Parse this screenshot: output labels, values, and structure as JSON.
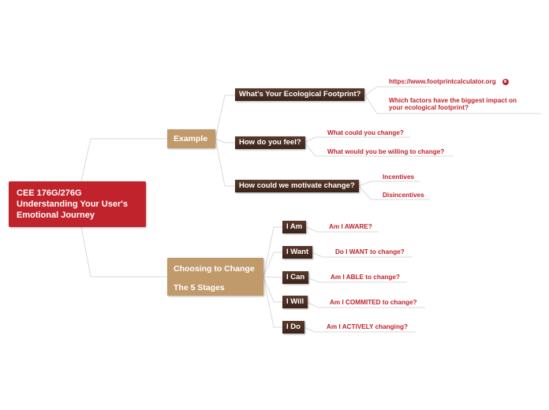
{
  "root": {
    "line1": "CEE 176G/276G",
    "line2": "Understanding Your User's",
    "line3": "Emotional Journey"
  },
  "branches": [
    {
      "label": "Example",
      "children": [
        {
          "label": "What's Your Ecological Footprint?",
          "leaves": [
            {
              "text": "https://www.footprintcalculator.org",
              "icon": "globe-link-icon"
            },
            {
              "text": "Which factors have the biggest impact on your ecological footprint?"
            }
          ]
        },
        {
          "label": "How do you feel?",
          "leaves": [
            {
              "text": "What could you change?"
            },
            {
              "text": "What would you be willing to change?"
            }
          ]
        },
        {
          "label": "How could we motivate change?",
          "leaves": [
            {
              "text": "Incentives"
            },
            {
              "text": "Disincentives"
            }
          ]
        }
      ]
    },
    {
      "label_line1": "Choosing to Change",
      "label_line2": "The 5 Stages",
      "children": [
        {
          "label": "I Am",
          "leaf": "Am I AWARE?"
        },
        {
          "label": "I Want",
          "leaf": "Do I WANT to change?"
        },
        {
          "label": "I Can",
          "leaf": "Am I ABLE to change?"
        },
        {
          "label": "I Will",
          "leaf": "Am I COMMITED to change?"
        },
        {
          "label": "I Do",
          "leaf": "Am I ACTIVELY changing?"
        }
      ]
    }
  ],
  "colors": {
    "root": "#c0232b",
    "branch": "#c09a6b",
    "topic": "#4a2f23",
    "leaf_text": "#c0232b",
    "line": "#d8d8d8"
  }
}
